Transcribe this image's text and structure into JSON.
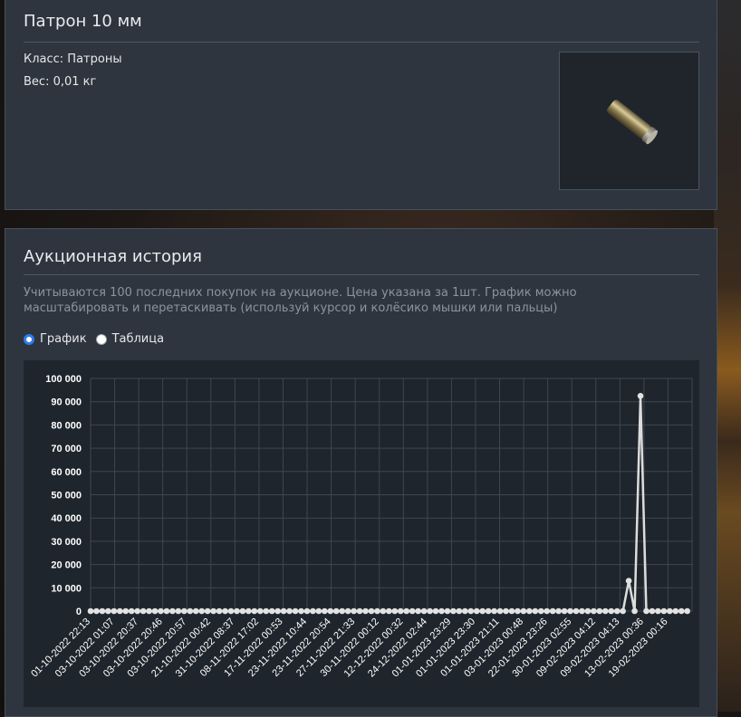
{
  "item": {
    "title": "Патрон 10 мм",
    "class_text": "Класс: Патроны",
    "weight_text": "Вес: 0,01 кг",
    "image_icon": "cartridge-icon"
  },
  "auction": {
    "title": "Аукционная история",
    "description": "Учитываются 100 последних покупок на аукционе. Цена указана за 1шт. График можно масштабировать и перетаскивать (используй курсор и колёсико мышки или пальцы)",
    "view_options": [
      {
        "label": "График",
        "selected": true
      },
      {
        "label": "Таблица",
        "selected": false
      }
    ]
  },
  "colors": {
    "accent": "#2f7be8",
    "card_bg": "#2e353e",
    "chart_bg": "#1f252c",
    "line": "#dcdcdc"
  },
  "chart_data": {
    "type": "line",
    "ylim": [
      0,
      100000
    ],
    "y_ticks": [
      "0",
      "10 000",
      "20 000",
      "30 000",
      "40 000",
      "50 000",
      "60 000",
      "70 000",
      "80 000",
      "90 000",
      "100 000"
    ],
    "x_tick_labels": [
      "01-10-2022 22:13",
      "03-10-2022 01:07",
      "03-10-2022 20:37",
      "03-10-2022 20:46",
      "03-10-2022 20:57",
      "21-10-2022 00:42",
      "31-10-2022 08:37",
      "08-11-2022 17:02",
      "17-11-2022 00:53",
      "23-11-2022 10:44",
      "23-11-2022 20:54",
      "27-11-2022 21:33",
      "30-11-2022 00:12",
      "12-12-2022 00:32",
      "24-12-2022 02:44",
      "01-01-2023 23:29",
      "01-01-2023 23:30",
      "01-01-2023 21:11",
      "03-01-2023 00:48",
      "22-01-2023 23:26",
      "30-01-2023 02:55",
      "09-02-2023 04:12",
      "09-02-2023 04:13",
      "13-02-2023 00:36",
      "19-02-2023 00:16"
    ],
    "grid": true,
    "legend": "none",
    "series": [
      {
        "values": [
          0,
          0,
          0,
          0,
          0,
          0,
          0,
          0,
          0,
          0,
          0,
          0,
          0,
          0,
          0,
          0,
          0,
          0,
          0,
          0,
          0,
          0,
          0,
          0,
          0,
          0,
          0,
          0,
          0,
          0,
          0,
          0,
          0,
          0,
          0,
          0,
          0,
          0,
          0,
          0,
          0,
          0,
          0,
          0,
          0,
          0,
          0,
          0,
          0,
          0,
          0,
          0,
          0,
          0,
          0,
          0,
          0,
          0,
          0,
          0,
          0,
          0,
          0,
          0,
          0,
          0,
          0,
          0,
          0,
          0,
          0,
          0,
          0,
          0,
          0,
          0,
          0,
          0,
          0,
          0,
          0,
          0,
          0,
          0,
          0,
          0,
          0,
          0,
          0,
          0,
          0,
          0,
          13000,
          0,
          92500,
          0,
          0,
          0,
          0,
          0,
          0,
          0,
          0
        ]
      }
    ]
  }
}
